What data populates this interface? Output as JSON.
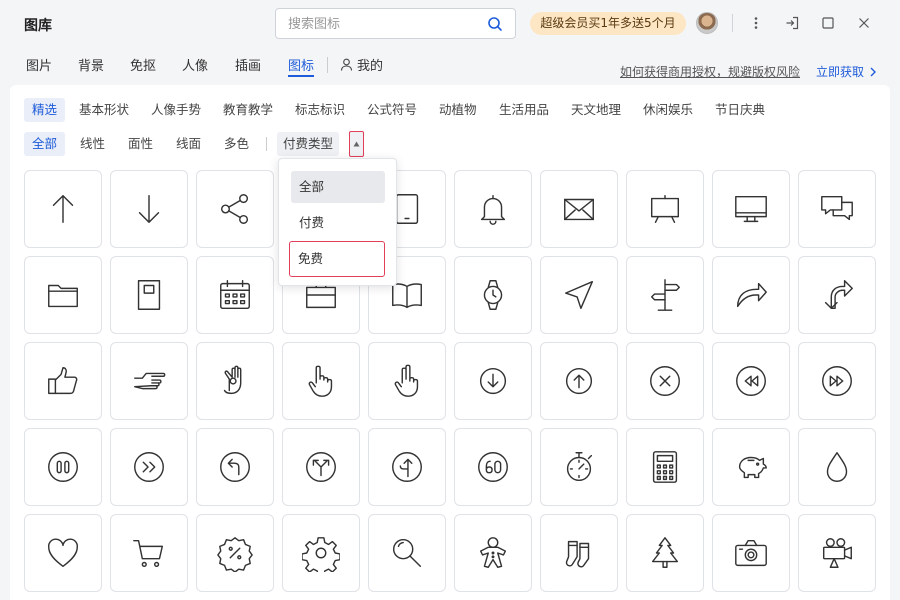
{
  "app": {
    "title": "图库"
  },
  "search": {
    "placeholder": "搜索图标"
  },
  "vip": {
    "label": "超级会员买1年多送5个月"
  },
  "tabs": [
    {
      "label": "图片"
    },
    {
      "label": "背景"
    },
    {
      "label": "免抠"
    },
    {
      "label": "人像"
    },
    {
      "label": "插画"
    },
    {
      "label": "图标"
    }
  ],
  "mine": {
    "label": "我的"
  },
  "links": {
    "license": "如何获得商用授权，规避版权风险",
    "get": "立即获取"
  },
  "categories": [
    "精选",
    "基本形状",
    "人像手势",
    "教育教学",
    "标志标识",
    "公式符号",
    "动植物",
    "生活用品",
    "天文地理",
    "休闲娱乐",
    "节日庆典"
  ],
  "styles": [
    "全部",
    "线性",
    "面性",
    "线面",
    "多色"
  ],
  "pay_filter": {
    "label": "付费类型"
  },
  "dropdown": {
    "options": [
      "全部",
      "付费",
      "免费"
    ]
  },
  "icons": [
    "arrow-up-icon",
    "arrow-down-icon",
    "share-icon",
    "tablet-icon",
    "tablet-icon",
    "bell-icon",
    "mail-icon",
    "presentation-board-icon",
    "monitor-icon",
    "chat-bubbles-icon",
    "folder-icon",
    "notebook-icon",
    "calendar-icon",
    "briefcase-icon",
    "open-book-icon",
    "wristwatch-icon",
    "navigation-arrow-icon",
    "signpost-icon",
    "curved-arrow-right-icon",
    "branch-arrow-icon",
    "thumbs-up-icon",
    "pointing-hand-icon",
    "ok-hand-icon",
    "hand-pointing-up-icon",
    "hand-peace-icon",
    "circle-arrow-down-icon",
    "circle-arrow-up-icon",
    "circle-close-icon",
    "circle-rewind-icon",
    "circle-fast-forward-icon",
    "circle-pause-icon",
    "circle-chevrons-right-icon",
    "circle-turn-left-icon",
    "circle-split-arrows-icon",
    "circle-merge-arrow-icon",
    "speed-limit-60-icon",
    "stopwatch-icon",
    "calculator-icon",
    "piggy-bank-icon",
    "water-drop-icon",
    "heart-icon",
    "shopping-cart-icon",
    "discount-badge-icon",
    "gear-icon",
    "magnifier-icon",
    "gingerbread-man-icon",
    "christmas-stockings-icon",
    "christmas-tree-icon",
    "camera-icon",
    "movie-camera-icon"
  ]
}
